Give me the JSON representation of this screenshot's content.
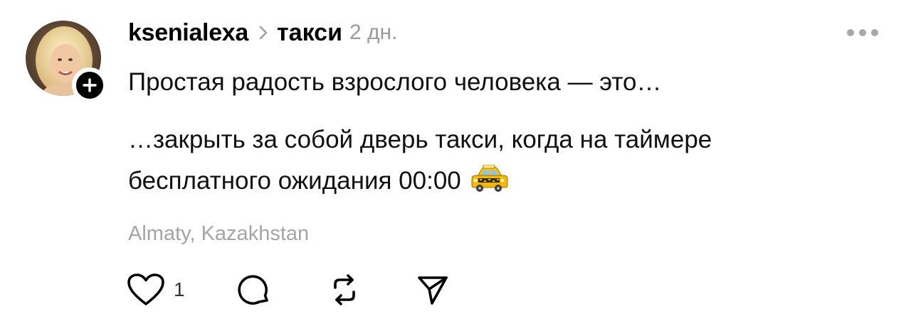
{
  "post": {
    "username": "ksenialexa",
    "topic": "такси",
    "time": "2 дн.",
    "text_line1": "Простая радость взрослого человека — это…",
    "text_line2": "…закрыть за собой дверь такси, когда на таймере",
    "text_line3": "бесплатного ожидания 00:00",
    "location": "Almaty, Kazakhstan",
    "likes": "1"
  },
  "icons": {
    "avatar": "avatar",
    "follow": "plus-icon",
    "separator": "chevron-right-icon",
    "more": "more-horizontal-icon",
    "emoji": "taxi-emoji",
    "like": "heart-icon",
    "reply": "comment-icon",
    "repost": "repost-icon",
    "share": "send-icon"
  },
  "colors": {
    "text": "#000000",
    "muted": "#9a9a9a",
    "taxi_yellow": "#f5b800"
  }
}
